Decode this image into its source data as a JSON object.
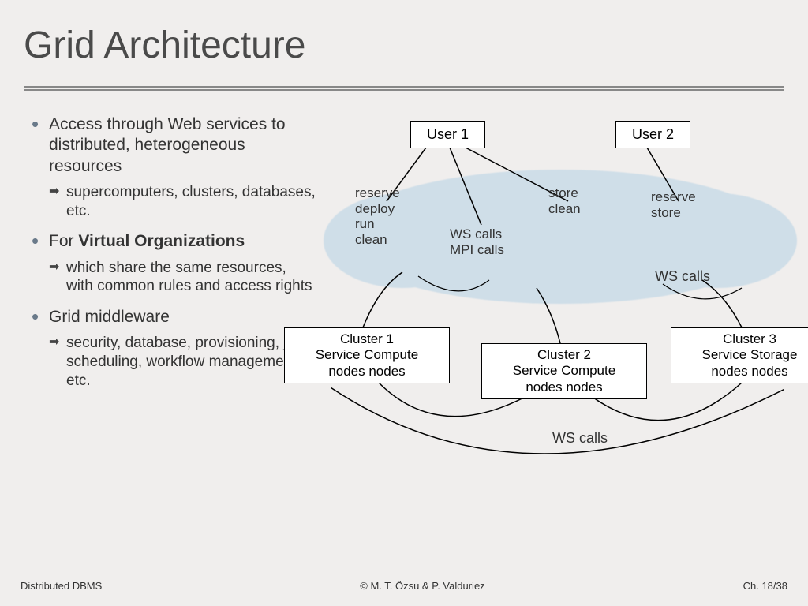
{
  "title": "Grid Architecture",
  "bullets": {
    "b1": "Access through Web services to distributed, heterogeneous resources",
    "b1s1": "supercomputers, clusters, databases, etc.",
    "b2_pre": "For ",
    "b2_bold": "Virtual Organizations",
    "b2s1": "which share the same resources, with common rules and access rights",
    "b3": "Grid middleware",
    "b3s1": "security, database, provisioning, job scheduling, workflow management, etc."
  },
  "diagram": {
    "user1": "User 1",
    "user2": "User 2",
    "actions1": "reserve\ndeploy\nrun\nclean",
    "actions2": "WS calls\nMPI calls",
    "actions3": "store\nclean",
    "actions4": "reserve\nstore",
    "wscalls_right": "WS calls",
    "wscalls_bottom": "WS calls",
    "cluster1": "Cluster 1\nService    Compute\nnodes       nodes",
    "cluster2": "Cluster 2\nService    Compute\nnodes       nodes",
    "cluster3": "Cluster 3\nService      Storage\nnodes        nodes"
  },
  "footer": {
    "left": "Distributed DBMS",
    "center": "© M. T. Özsu & P. Valduriez",
    "right": "Ch. 18/38"
  }
}
